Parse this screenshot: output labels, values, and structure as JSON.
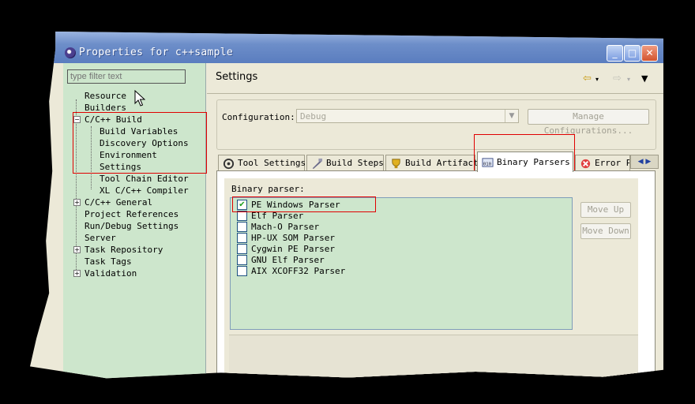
{
  "window": {
    "title": "Properties for c++sample"
  },
  "filter": {
    "placeholder": "type filter text"
  },
  "tree": [
    {
      "label": "Resource",
      "level": 0,
      "expander": ""
    },
    {
      "label": "Builders",
      "level": 0,
      "expander": ""
    },
    {
      "label": "C/C++ Build",
      "level": 0,
      "expander": "−"
    },
    {
      "label": "Build Variables",
      "level": 1,
      "expander": ""
    },
    {
      "label": "Discovery Options",
      "level": 1,
      "expander": ""
    },
    {
      "label": "Environment",
      "level": 1,
      "expander": ""
    },
    {
      "label": "Settings",
      "level": 1,
      "expander": ""
    },
    {
      "label": "Tool Chain Editor",
      "level": 1,
      "expander": ""
    },
    {
      "label": "XL C/C++ Compiler",
      "level": 1,
      "expander": ""
    },
    {
      "label": "C/C++ General",
      "level": 0,
      "expander": "+"
    },
    {
      "label": "Project References",
      "level": 0,
      "expander": ""
    },
    {
      "label": "Run/Debug Settings",
      "level": 0,
      "expander": ""
    },
    {
      "label": "Server",
      "level": 0,
      "expander": ""
    },
    {
      "label": "Task Repository",
      "level": 0,
      "expander": "+"
    },
    {
      "label": "Task Tags",
      "level": 0,
      "expander": ""
    },
    {
      "label": "Validation",
      "level": 0,
      "expander": "+"
    }
  ],
  "page": {
    "title": "Settings"
  },
  "configuration": {
    "label": "Configuration:",
    "value": "Debug",
    "manage_label": "Manage Configurations..."
  },
  "tabs": [
    {
      "label": "Tool Settings",
      "icon": "tool-settings-icon"
    },
    {
      "label": "Build Steps",
      "icon": "build-steps-icon"
    },
    {
      "label": "Build Artifact",
      "icon": "build-artifact-icon"
    },
    {
      "label": "Binary Parsers",
      "icon": "binary-parsers-icon"
    },
    {
      "label": "Error Pa",
      "icon": "error-icon"
    }
  ],
  "binary_parser": {
    "label": "Binary parser:",
    "items": [
      {
        "label": "PE Windows Parser",
        "checked": true
      },
      {
        "label": "Elf Parser",
        "checked": false
      },
      {
        "label": "Mach-O Parser",
        "checked": false
      },
      {
        "label": "HP-UX SOM Parser",
        "checked": false
      },
      {
        "label": "Cygwin PE Parser",
        "checked": false
      },
      {
        "label": "GNU Elf Parser",
        "checked": false
      },
      {
        "label": "AIX XCOFF32 Parser",
        "checked": false
      }
    ],
    "move_up": "Move Up",
    "move_down": "Move Down"
  },
  "colors": {
    "highlight": "#e00000",
    "pane_bg": "#cde6cc",
    "title_bar": "#6d8ec9"
  }
}
